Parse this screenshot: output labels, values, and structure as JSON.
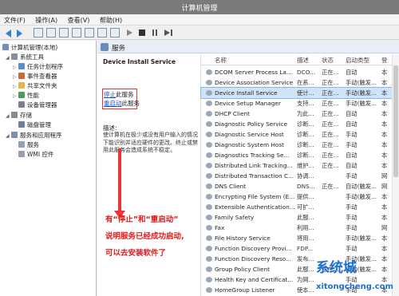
{
  "window": {
    "title": "计算机管理"
  },
  "menu": [
    "文件(F)",
    "操作(A)",
    "查看(V)",
    "帮助(H)"
  ],
  "tree": {
    "root": "计算机管理(本地)",
    "system_tools": "系统工具",
    "task_scheduler": "任务计划程序",
    "event_viewer": "事件查看器",
    "shared_folders": "共享文件夹",
    "performance": "性能",
    "device_manager": "设备管理器",
    "storage": "存储",
    "disk_management": "磁盘管理",
    "services_apps": "服务和应用程序",
    "services": "服务",
    "wmi": "WMI 控件"
  },
  "center": {
    "header": "服务",
    "service_name": "Device Install Service",
    "stop_link": "停止",
    "stop_suffix": "此服务",
    "restart_link": "重启动",
    "restart_suffix": "此服务",
    "desc_label": "描述:",
    "desc_text": "使计算机在极少或没有用户输入的情况下能识别并适应硬件的更改。终止或禁用此服务会造成系统不稳定。"
  },
  "annotation": {
    "line1": "有“停止”和“重启动”",
    "line2": "说明服务已经成功启动,",
    "line3": "可以去安装软件了"
  },
  "columns": {
    "name": "名称",
    "desc": "描述",
    "status": "状态",
    "startup": "启动类型",
    "logon": "登"
  },
  "rows": [
    {
      "name": "DCOM Server Process La...",
      "desc": "DCO...",
      "status": "正在...",
      "startup": "自动",
      "logon": "本"
    },
    {
      "name": "Device Association Service",
      "desc": "在系...",
      "status": "正在...",
      "startup": "手动(触发...",
      "logon": "本"
    },
    {
      "name": "Device Install Service",
      "desc": "使计...",
      "status": "正在...",
      "startup": "手动(触发...",
      "logon": "本",
      "selected": true
    },
    {
      "name": "Device Setup Manager",
      "desc": "支持...",
      "status": "正在...",
      "startup": "手动(触发...",
      "logon": "本"
    },
    {
      "name": "DHCP Client",
      "desc": "为此...",
      "status": "正在...",
      "startup": "自动",
      "logon": "本"
    },
    {
      "name": "Diagnostic Policy Service",
      "desc": "诊断...",
      "status": "正在...",
      "startup": "自动",
      "logon": "本"
    },
    {
      "name": "Diagnostic Service Host",
      "desc": "诊断...",
      "status": "正在...",
      "startup": "手动",
      "logon": "本"
    },
    {
      "name": "Diagnostic System Host",
      "desc": "诊断...",
      "status": "正在...",
      "startup": "手动",
      "logon": "本"
    },
    {
      "name": "Diagnostics Tracking Se...",
      "desc": "诊断...",
      "status": "正在...",
      "startup": "自动",
      "logon": "本"
    },
    {
      "name": "Distributed Link Tracking...",
      "desc": "维护...",
      "status": "正在...",
      "startup": "自动",
      "logon": "本"
    },
    {
      "name": "Distributed Transaction C...",
      "desc": "协调...",
      "status": "",
      "startup": "手动",
      "logon": "网"
    },
    {
      "name": "DNS Client",
      "desc": "DNS...",
      "status": "正在...",
      "startup": "自动(触发...",
      "logon": "网"
    },
    {
      "name": "Encrypting File System (E...",
      "desc": "提供...",
      "status": "",
      "startup": "手动(触发...",
      "logon": "本"
    },
    {
      "name": "Extensible Authentication...",
      "desc": "可扩...",
      "status": "",
      "startup": "手动",
      "logon": "本"
    },
    {
      "name": "Family Safety",
      "desc": "此服...",
      "status": "",
      "startup": "手动",
      "logon": "本"
    },
    {
      "name": "Fax",
      "desc": "利用...",
      "status": "",
      "startup": "手动",
      "logon": "网"
    },
    {
      "name": "File History Service",
      "desc": "将用...",
      "status": "",
      "startup": "手动(触发...",
      "logon": "本"
    },
    {
      "name": "Function Discovery Provi...",
      "desc": "FDP...",
      "status": "",
      "startup": "手动",
      "logon": "本"
    },
    {
      "name": "Function Discovery Reso...",
      "desc": "发布...",
      "status": "",
      "startup": "手动(触发...",
      "logon": "本"
    },
    {
      "name": "Group Policy Client",
      "desc": "此服...",
      "status": "正在...",
      "startup": "自动(触发...",
      "logon": "本"
    },
    {
      "name": "Health Key and Certificat...",
      "desc": "为网...",
      "status": "",
      "startup": "手动",
      "logon": "本"
    },
    {
      "name": "HomeGroup Listener",
      "desc": "使本...",
      "status": "",
      "startup": "手动",
      "logon": "本"
    }
  ],
  "watermark": {
    "logo": "系统城",
    "url": "xitongcheng.com"
  }
}
